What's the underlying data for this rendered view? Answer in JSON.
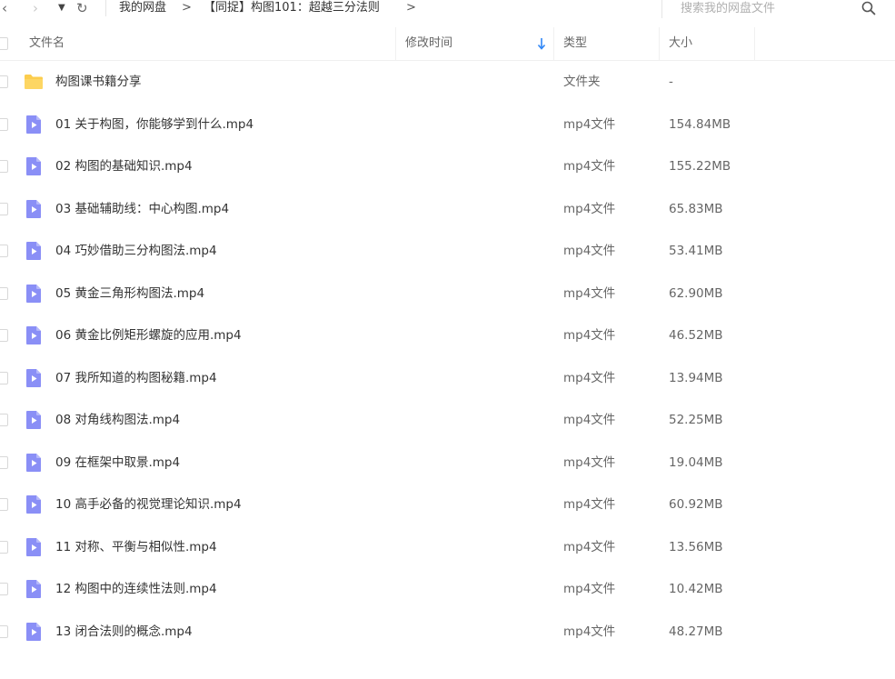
{
  "nav": {
    "back": "‹",
    "forward": "›",
    "dropdown": "▼",
    "refresh": "↻"
  },
  "breadcrumb": {
    "root": "我的网盘",
    "folder": "【同捉】构图101：超越三分法则",
    "separator": ">"
  },
  "search": {
    "placeholder": "搜索我的网盘文件"
  },
  "columns": {
    "name": "文件名",
    "modified": "修改时间",
    "type": "类型",
    "size": "大小"
  },
  "colors": {
    "folder": "#fccd4d",
    "video_icon": "#8a8ff6",
    "sort_arrow": "#2f86f6"
  },
  "files": [
    {
      "name": "构图课书籍分享",
      "type": "文件夹",
      "size": "-",
      "icon": "folder-icon"
    },
    {
      "name": "01 关于构图，你能够学到什么.mp4",
      "type": "mp4文件",
      "size": "154.84MB",
      "icon": "video-file-icon"
    },
    {
      "name": "02 构图的基础知识.mp4",
      "type": "mp4文件",
      "size": "155.22MB",
      "icon": "video-file-icon"
    },
    {
      "name": "03 基础辅助线：中心构图.mp4",
      "type": "mp4文件",
      "size": "65.83MB",
      "icon": "video-file-icon"
    },
    {
      "name": "04 巧妙借助三分构图法.mp4",
      "type": "mp4文件",
      "size": "53.41MB",
      "icon": "video-file-icon"
    },
    {
      "name": "05 黄金三角形构图法.mp4",
      "type": "mp4文件",
      "size": "62.90MB",
      "icon": "video-file-icon"
    },
    {
      "name": "06 黄金比例矩形螺旋的应用.mp4",
      "type": "mp4文件",
      "size": "46.52MB",
      "icon": "video-file-icon"
    },
    {
      "name": "07 我所知道的构图秘籍.mp4",
      "type": "mp4文件",
      "size": "13.94MB",
      "icon": "video-file-icon"
    },
    {
      "name": "08 对角线构图法.mp4",
      "type": "mp4文件",
      "size": "52.25MB",
      "icon": "video-file-icon"
    },
    {
      "name": "09 在框架中取景.mp4",
      "type": "mp4文件",
      "size": "19.04MB",
      "icon": "video-file-icon"
    },
    {
      "name": "10 高手必备的视觉理论知识.mp4",
      "type": "mp4文件",
      "size": "60.92MB",
      "icon": "video-file-icon"
    },
    {
      "name": "11 对称、平衡与相似性.mp4",
      "type": "mp4文件",
      "size": "13.56MB",
      "icon": "video-file-icon"
    },
    {
      "name": "12 构图中的连续性法则.mp4",
      "type": "mp4文件",
      "size": "10.42MB",
      "icon": "video-file-icon"
    },
    {
      "name": "13 闭合法则的概念.mp4",
      "type": "mp4文件",
      "size": "48.27MB",
      "icon": "video-file-icon"
    }
  ]
}
